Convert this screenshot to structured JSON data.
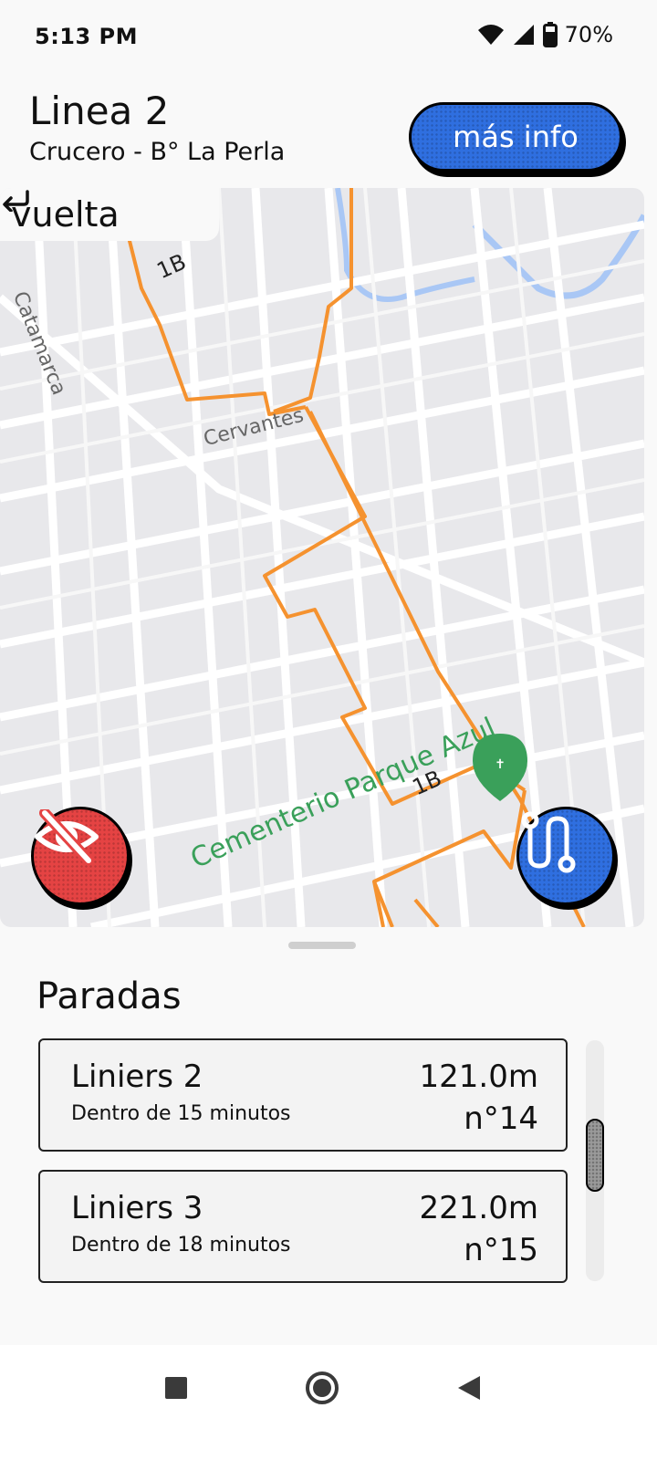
{
  "status_bar": {
    "time": "5:13 PM",
    "battery_percent": "70%"
  },
  "header": {
    "line_name": "Linea 2",
    "route": "Crucero - B° La Perla",
    "info_button_label": "más info"
  },
  "map": {
    "direction_label": "vuelta",
    "street_labels": [
      "Catamarca",
      "Cervantes"
    ],
    "route_badges": [
      "1B",
      "1B"
    ],
    "poi_label": "Cementerio Parque Azul",
    "route_color": "#f5922f"
  },
  "stops_section": {
    "title": "Paradas",
    "items": [
      {
        "name": "Liniers 2",
        "eta": "Dentro de 15 minutos",
        "distance": "121.0m",
        "number": "n°14"
      },
      {
        "name": "Liniers 3",
        "eta": "Dentro de 18 minutos",
        "distance": "221.0m",
        "number": "n°15"
      }
    ]
  },
  "colors": {
    "accent_blue": "#2f6fe0",
    "danger_red": "#e54343"
  }
}
